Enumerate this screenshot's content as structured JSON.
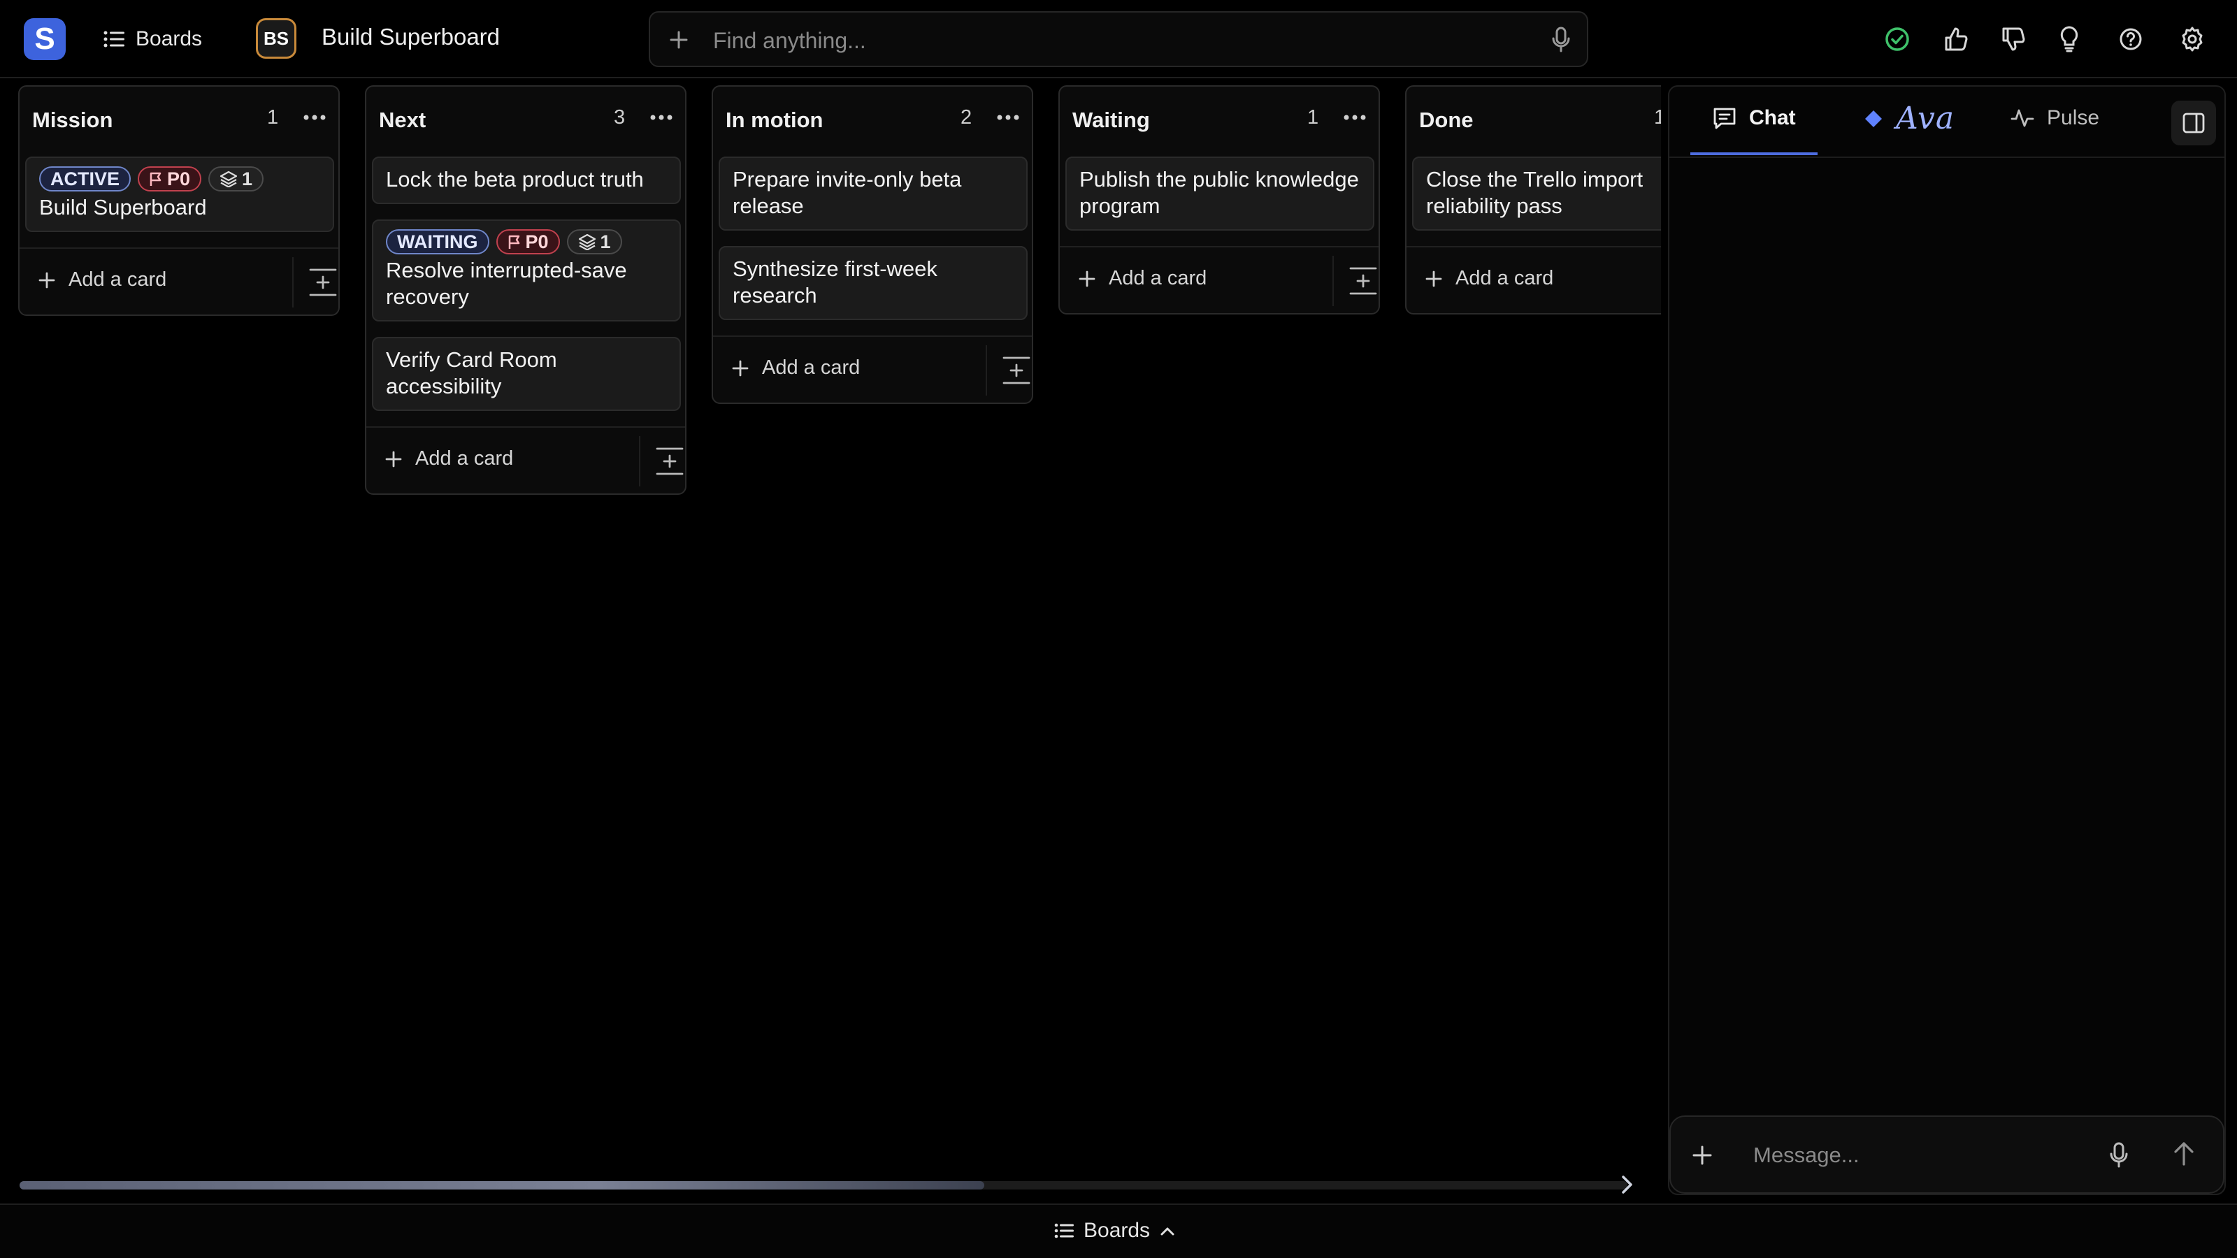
{
  "app": {
    "logo_letter": "S",
    "accent": "#3d63dd"
  },
  "topbar": {
    "boards_label": "Boards",
    "board_initials": "BS",
    "board_title": "Build Superboard",
    "search_placeholder": "Find anything..."
  },
  "columns": [
    {
      "title": "Mission",
      "count": "1",
      "cards": [
        {
          "badges": [
            {
              "type": "status",
              "label": "ACTIVE"
            },
            {
              "type": "priority",
              "label": "P0"
            },
            {
              "type": "layers",
              "label": "1"
            }
          ],
          "title": "Build Superboard"
        }
      ],
      "add_label": "Add a card"
    },
    {
      "title": "Next",
      "count": "3",
      "cards": [
        {
          "badges": [],
          "title": "Lock the beta product truth"
        },
        {
          "badges": [
            {
              "type": "status",
              "label": "WAITING"
            },
            {
              "type": "priority",
              "label": "P0"
            },
            {
              "type": "layers",
              "label": "1"
            }
          ],
          "title": "Resolve interrupted-save recovery"
        },
        {
          "badges": [],
          "title": "Verify Card Room accessibility"
        }
      ],
      "add_label": "Add a card"
    },
    {
      "title": "In motion",
      "count": "2",
      "cards": [
        {
          "badges": [],
          "title": "Prepare invite-only beta release"
        },
        {
          "badges": [],
          "title": "Synthesize first-week research"
        }
      ],
      "add_label": "Add a card"
    },
    {
      "title": "Waiting",
      "count": "1",
      "cards": [
        {
          "badges": [],
          "title": "Publish the public knowledge program"
        }
      ],
      "add_label": "Add a card"
    },
    {
      "title": "Done",
      "count": "1",
      "cards": [
        {
          "badges": [],
          "title": "Close the Trello import reliability pass"
        }
      ],
      "add_label": "Add a card"
    }
  ],
  "board_scroll": {
    "position_fraction": 0.6
  },
  "panel": {
    "tabs": [
      {
        "label": "Chat",
        "icon": "chat-bubble-icon",
        "active": true
      },
      {
        "label": "Ava",
        "icon": "diamond-icon",
        "active": false
      },
      {
        "label": "Pulse",
        "icon": "pulse-icon",
        "active": false
      }
    ],
    "message_placeholder": "Message..."
  },
  "bottombar": {
    "boards_label": "Boards"
  }
}
